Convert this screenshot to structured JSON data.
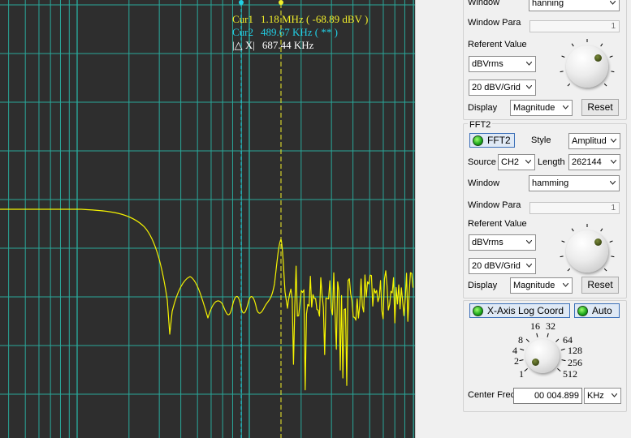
{
  "colors": {
    "background": "#2e2e2e",
    "grid": "#2aa89a",
    "trace": "#f6f400",
    "cursor1": "#f2ef2a",
    "cursor2": "#22d0e6",
    "led": "#1aa51a"
  },
  "plot": {
    "cursor1": {
      "label": "Cur1",
      "value": "1.18 MHz ( -68.89 dBV )"
    },
    "cursor2": {
      "label": "Cur2",
      "value": "489.67 KHz ( ** )"
    },
    "delta": {
      "label": "|△ X|",
      "value": "687.44 KHz"
    }
  },
  "fft1": {
    "window_label": "Window",
    "window_value": "hanning",
    "window_para_label": "Window Para",
    "window_para_value": "1",
    "ref_label": "Referent Value",
    "ref_unit": "dBVrms",
    "grid": "20 dBV/Grid",
    "display_label": "Display",
    "display_value": "Magnitude",
    "reset": "Reset"
  },
  "fft2": {
    "group_title": "FFT2",
    "toggle": "FFT2",
    "style_label": "Style",
    "style_value": "Amplitud",
    "source_label": "Source",
    "source_value": "CH2",
    "length_label": "Length",
    "length_value": "262144",
    "window_label": "Window",
    "window_value": "hamming",
    "window_para_label": "Window Para",
    "window_para_value": "1",
    "ref_label": "Referent Value",
    "ref_unit": "dBVrms",
    "grid": "20 dBV/Grid",
    "display_label": "Display",
    "display_value": "Magnitude",
    "reset": "Reset"
  },
  "xaxis": {
    "log_toggle": "X-Axis Log Coord",
    "auto_toggle": "Auto",
    "scale_labels": [
      "1",
      "2",
      "4",
      "8",
      "16",
      "32",
      "64",
      "128",
      "256",
      "512"
    ],
    "center_freq_label": "Center Frec",
    "center_freq_value": "00 004.899",
    "unit": "KHz"
  }
}
